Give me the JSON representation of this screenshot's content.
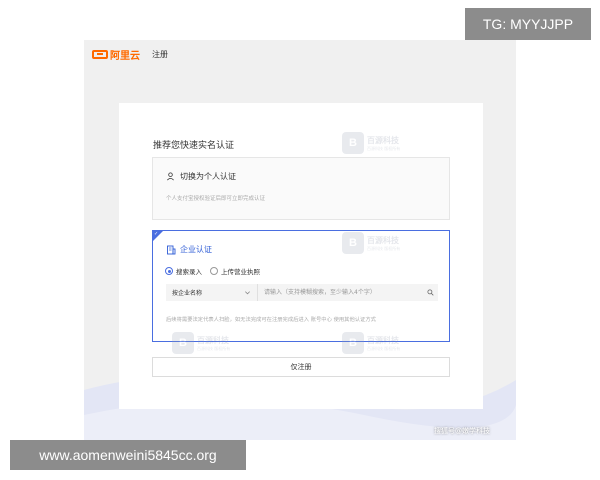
{
  "overlay": {
    "tg_label": "TG: MYYJJPP",
    "url_label": "www.aomenweini5845cc.org",
    "source_label": "搜狐号@嫩学科技"
  },
  "header": {
    "logo_text": "阿里云",
    "page_title": "注册"
  },
  "form": {
    "heading": "推荐您快速实名认证",
    "personal": {
      "title": "切换为个人认证",
      "desc": "个人支付宝授权验证后即可立即完成认证"
    },
    "company": {
      "title": "企业认证",
      "radio_search": "搜索录入",
      "radio_upload": "上传营业执照",
      "select_value": "按企业名称",
      "search_placeholder": "请输入（支持模糊搜索，至少输入4个字）",
      "desc": "后续将需要法定代表人扫脸，如无法完成可在注册完成后进入 账号中心 使用其他认证方式"
    },
    "register_only_label": "仅注册"
  },
  "watermark": {
    "logo": "B",
    "name": "百源科技",
    "sub": "百源科技 版权所有"
  },
  "colors": {
    "brand": "#ff6a00",
    "accent": "#4a6ee0"
  }
}
